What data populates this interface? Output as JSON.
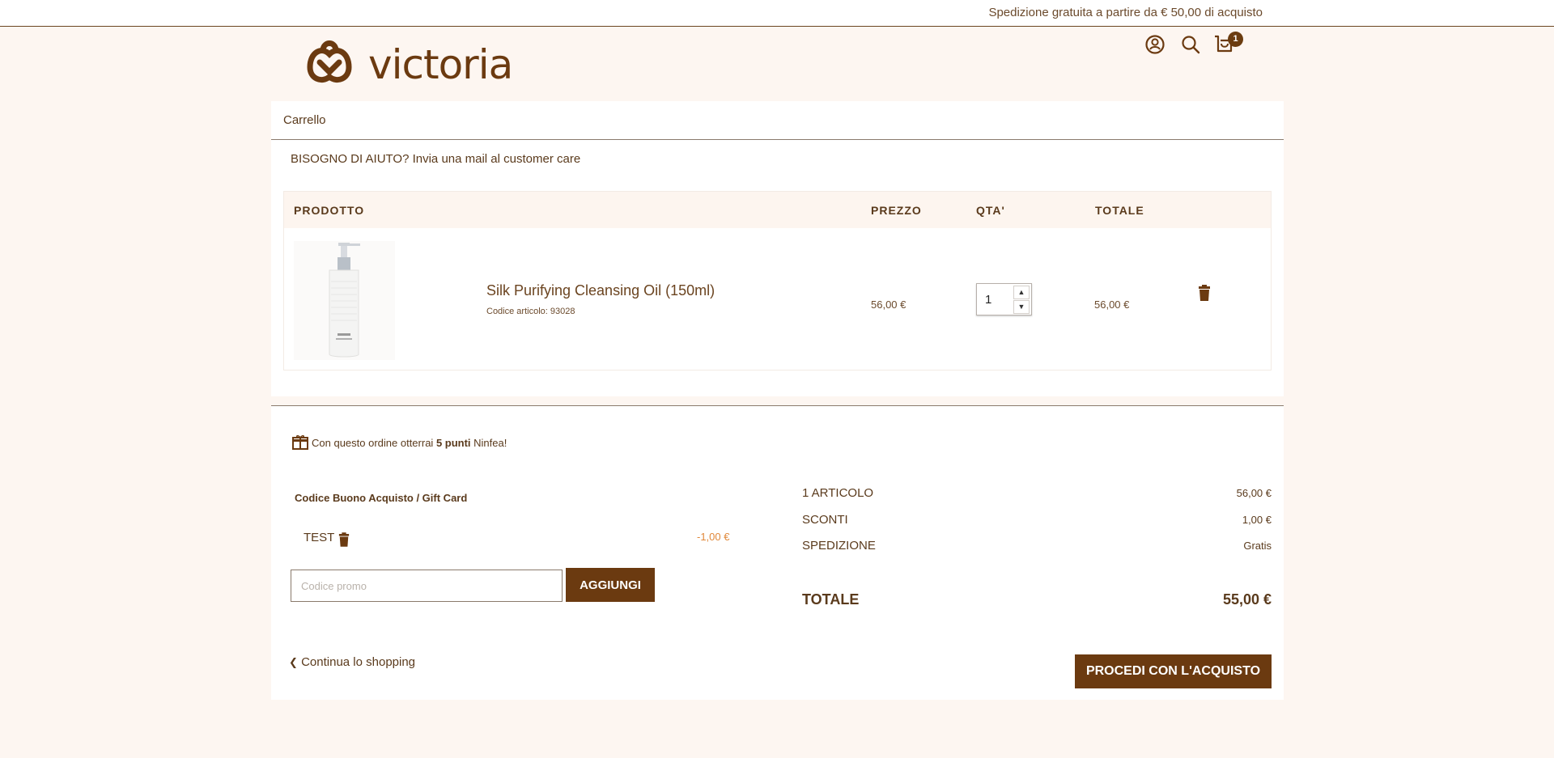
{
  "topbar": {
    "promo": "Spedizione gratuita a partire da € 50,00 di acquisto"
  },
  "header": {
    "logo_text": "victoria",
    "cart_count": "1",
    "icons": [
      "user-icon",
      "search-icon",
      "cart-icon"
    ]
  },
  "breadcrumb": "Carrello",
  "help": {
    "prefix": "BISOGNO DI AIUTO? ",
    "link": "Invia una mail al customer care"
  },
  "table": {
    "headers": {
      "product": "PRODOTTO",
      "price": "PREZZO",
      "qty": "QTA'",
      "total": "TOTALE"
    },
    "items": [
      {
        "name": "Silk Purifying Cleansing Oil (150ml)",
        "code": "Codice articolo: 93028",
        "price": "56,00 €",
        "qty": "1",
        "total": "56,00 €"
      }
    ]
  },
  "points": {
    "prefix": "Con questo ordine otterrai ",
    "bold": "5 punti",
    "suffix": " Ninfea!"
  },
  "giftcard": {
    "title": "Codice Buono Acquisto / Gift Card",
    "applied_code": "TEST",
    "applied_value": "-1,00 €",
    "placeholder": "Codice promo",
    "add_label": "AGGIUNGI"
  },
  "continue_label": "Continua lo shopping",
  "summary": {
    "rows": [
      {
        "label": "1 ARTICOLO",
        "value": "56,00 €"
      },
      {
        "label": "SCONTI",
        "value": "1,00 €"
      },
      {
        "label": "SPEDIZIONE",
        "value": "Gratis"
      }
    ],
    "total_label": "TOTALE",
    "total_value": "55,00 €",
    "checkout_label": "PROCEDI CON L'ACQUISTO"
  },
  "colors": {
    "brand": "#6b3a10",
    "bg": "#fdf6f1",
    "accent": "#e0883a"
  }
}
